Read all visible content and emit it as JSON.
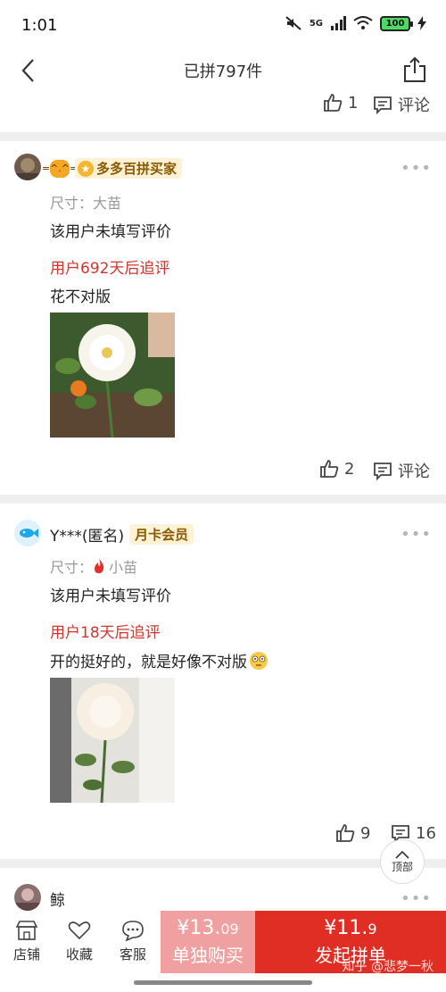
{
  "status": {
    "time": "1:01",
    "network": "5G",
    "battery": "100"
  },
  "nav": {
    "title": "已拼797件"
  },
  "prev_card": {
    "likes": "1",
    "comment_label": "评论"
  },
  "reviews": [
    {
      "username": "",
      "badge": "多多百拼买家",
      "spec_label": "尺寸：",
      "spec_value": "大苗",
      "text": "该用户未填写评价",
      "followup": "用户692天后追评",
      "followup_text": "花不对版",
      "likes": "2",
      "comment_label": "评论"
    },
    {
      "username": "Y***(匿名)",
      "badge": "月卡会员",
      "spec_label": "尺寸：",
      "spec_value": "小苗",
      "text": "该用户未填写评价",
      "followup": "用户18天后追评",
      "followup_text": "开的挺好的，就是好像不对版",
      "likes": "9",
      "comments": "16"
    },
    {
      "username": "鲸"
    }
  ],
  "more_label": "•••",
  "back_to_top": "顶部",
  "bottom_bar": {
    "store": "店铺",
    "favorite": "收藏",
    "service": "客服",
    "single_price_main": "¥13.",
    "single_price_decimal": "09",
    "single_label": "单独购买",
    "group_price_main": "¥11.",
    "group_price_decimal": "9",
    "group_label": "发起拼单",
    "watermark": "知乎 @悲梦一秋"
  },
  "colors": {
    "accent": "#e02e24",
    "followup": "#d2352d",
    "single_btn": "#f0a0a0"
  }
}
